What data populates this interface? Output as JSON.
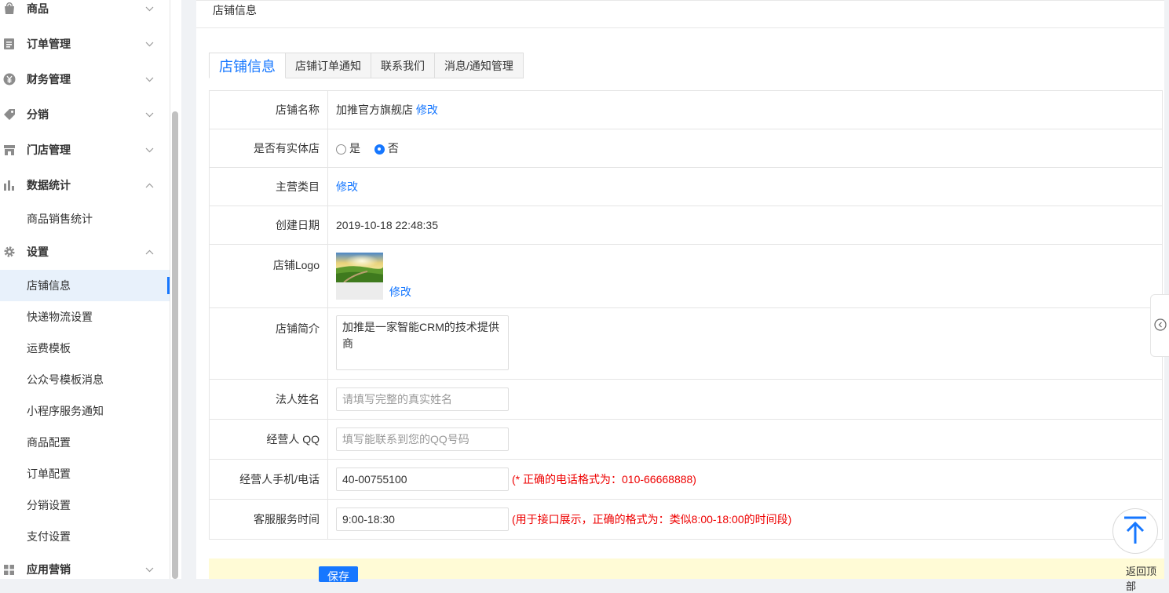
{
  "sidebar": {
    "groups": [
      {
        "label": "商品",
        "icon": "bag-icon"
      },
      {
        "label": "订单管理",
        "icon": "order-list-icon"
      },
      {
        "label": "财务管理",
        "icon": "yen-icon"
      },
      {
        "label": "分销",
        "icon": "tag-icon"
      },
      {
        "label": "门店管理",
        "icon": "store-icon"
      },
      {
        "label": "数据统计",
        "icon": "bar-chart-icon"
      },
      {
        "label": "设置",
        "icon": "gear-icon"
      },
      {
        "label": "应用营销",
        "icon": "grid-icon"
      }
    ],
    "stats_sub": [
      "商品销售统计"
    ],
    "settings_sub": [
      "店铺信息",
      "快递物流设置",
      "运费模板",
      "公众号模板消息",
      "小程序服务通知",
      "商品配置",
      "订单配置",
      "分销设置",
      "支付设置"
    ],
    "active_item": "店铺信息"
  },
  "breadcrumb": "店铺信息",
  "tabs": [
    "店铺信息",
    "店铺订单通知",
    "联系我们",
    "消息/通知管理"
  ],
  "form": {
    "store_name": {
      "label": "店铺名称",
      "value": "加推官方旗舰店",
      "action": "修改"
    },
    "physical_store": {
      "label": "是否有实体店",
      "option_yes": "是",
      "option_no": "否",
      "selected": "否"
    },
    "main_category": {
      "label": "主营类目",
      "action": "修改"
    },
    "created_date": {
      "label": "创建日期",
      "value": "2019-10-18 22:48:35"
    },
    "logo": {
      "label": "店铺Logo",
      "action": "修改"
    },
    "intro": {
      "label": "店铺简介",
      "value": "加推是一家智能CRM的技术提供商"
    },
    "legal_name": {
      "label": "法人姓名",
      "placeholder": "请填写完整的真实姓名",
      "value": ""
    },
    "qq": {
      "label": "经营人 QQ",
      "placeholder": "填写能联系到您的QQ号码",
      "value": ""
    },
    "phone": {
      "label": "经营人手机/电话",
      "value": "40-00755100",
      "hint": "(* 正确的电话格式为：010-66668888)"
    },
    "service_time": {
      "label": "客服服务时间",
      "value": "9:00-18:30",
      "hint": "(用于接口展示，正确的格式为：类似8:00-18:00的时间段)"
    }
  },
  "save_label": "保存",
  "back_to_top": "返回顶部",
  "colors": {
    "accent": "#1677ff",
    "error": "#e00000",
    "save_bar": "#fffbd6"
  }
}
